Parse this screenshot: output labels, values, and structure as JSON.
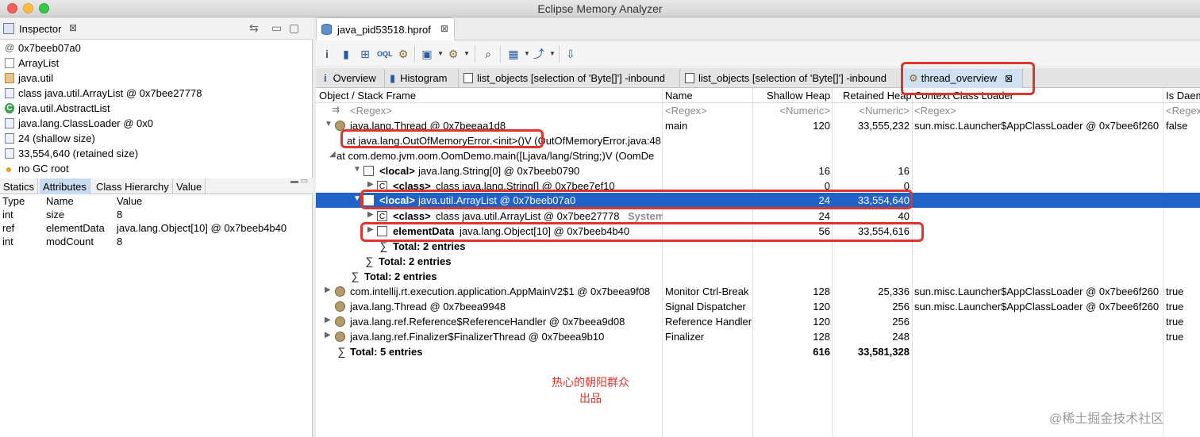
{
  "window": {
    "title": "Eclipse Memory Analyzer"
  },
  "inspector": {
    "title": "Inspector",
    "close": "⊠",
    "rows": [
      {
        "icon": "@",
        "text": "0x7beeb07a0"
      },
      {
        "icon": "file",
        "text": "ArrayList"
      },
      {
        "icon": "pkg",
        "text": "java.util"
      },
      {
        "icon": "obj",
        "text": "class java.util.ArrayList @ 0x7bee27778"
      },
      {
        "icon": "cls",
        "text": "java.util.AbstractList"
      },
      {
        "icon": "obj",
        "text": "java.lang.ClassLoader @ 0x0"
      },
      {
        "icon": "obj",
        "text": "24 (shallow size)"
      },
      {
        "icon": "obj",
        "text": "33,554,640 (retained size)"
      },
      {
        "icon": "dot",
        "text": "no GC root"
      }
    ],
    "tabs": [
      "Statics",
      "Attributes",
      "Class Hierarchy",
      "Value"
    ],
    "selected_tab": "Attributes",
    "columns": [
      "Type",
      "Name",
      "Value"
    ],
    "attributes": [
      {
        "type": "int",
        "name": "size",
        "value": "8"
      },
      {
        "type": "ref",
        "name": "elementData",
        "value": "java.lang.Object[10] @ 0x7beeb4b40"
      },
      {
        "type": "int",
        "name": "modCount",
        "value": "8"
      }
    ]
  },
  "editor": {
    "tab_label": "java_pid53518.hprof",
    "close": "⊠",
    "query_tabs": [
      {
        "label": "Overview"
      },
      {
        "label": "Histogram"
      },
      {
        "label": "list_objects [selection of 'Byte[]'] -inbound"
      },
      {
        "label": "list_objects [selection of 'Byte[]'] -inbound"
      },
      {
        "label": "thread_overview",
        "close": "⊠"
      }
    ]
  },
  "table": {
    "columns": [
      "Object / Stack Frame",
      "Name",
      "Shallow Heap",
      "Retained Heap",
      "Context Class Loader",
      "Is Daem"
    ],
    "filter": {
      "regex": "<Regex>",
      "numeric": "<Numeric>",
      "regex2": "<Regex>",
      "regex3": "<Regex"
    },
    "rows": [
      {
        "obj": "java.lang.Thread @ 0x7beeaa1d8",
        "name": "main",
        "shallow": "120",
        "retained": "33,555,232",
        "loader": "sun.misc.Launcher$AppClassLoader @ 0x7bee6f260",
        "daemon": "false"
      },
      {
        "obj": "at java.lang.OutOfMemoryError.<init>()V (OutOfMemoryError.java:48",
        "name": "",
        "shallow": "",
        "retained": "",
        "loader": "",
        "daemon": ""
      },
      {
        "obj": "at com.demo.jvm.oom.OomDemo.main([Ljava/lang/String;)V (OomDe",
        "name": "",
        "shallow": "",
        "retained": "",
        "loader": "",
        "daemon": ""
      },
      {
        "tag": "<local>",
        "obj": "java.lang.String[0] @ 0x7beeb0790",
        "name": "",
        "shallow": "16",
        "retained": "16",
        "loader": "",
        "daemon": ""
      },
      {
        "tag": "<class>",
        "obj": "class java.lang.String[] @ 0x7bee7ef10",
        "name": "",
        "shallow": "0",
        "retained": "0",
        "loader": "",
        "daemon": ""
      },
      {
        "tag": "<local>",
        "obj": "java.util.ArrayList @ 0x7beeb07a0",
        "name": "",
        "shallow": "24",
        "retained": "33,554,640",
        "loader": "",
        "daemon": ""
      },
      {
        "tag": "<class>",
        "obj": "class java.util.ArrayList @ 0x7bee27778",
        "suffix": "System",
        "name": "",
        "shallow": "24",
        "retained": "40",
        "loader": "",
        "daemon": ""
      },
      {
        "tag": "elementData",
        "obj": "java.lang.Object[10] @ 0x7beeb4b40",
        "name": "",
        "shallow": "56",
        "retained": "33,554,616",
        "loader": "",
        "daemon": ""
      },
      {
        "obj": "Total: 2 entries",
        "name": "",
        "shallow": "",
        "retained": "",
        "loader": "",
        "daemon": ""
      },
      {
        "obj": "Total: 2 entries",
        "name": "",
        "shallow": "",
        "retained": "",
        "loader": "",
        "daemon": ""
      },
      {
        "obj": "Total: 2 entries",
        "name": "",
        "shallow": "",
        "retained": "",
        "loader": "",
        "daemon": ""
      },
      {
        "obj": "com.intellij.rt.execution.application.AppMainV2$1 @ 0x7beea9f08",
        "name": "Monitor Ctrl-Break",
        "shallow": "128",
        "retained": "25,336",
        "loader": "sun.misc.Launcher$AppClassLoader @ 0x7bee6f260",
        "daemon": "true"
      },
      {
        "obj": "java.lang.Thread @ 0x7beea9948",
        "name": "Signal Dispatcher",
        "shallow": "120",
        "retained": "256",
        "loader": "sun.misc.Launcher$AppClassLoader @ 0x7bee6f260",
        "daemon": "true"
      },
      {
        "obj": "java.lang.ref.Reference$ReferenceHandler @ 0x7beea9d08",
        "name": "Reference Handler",
        "shallow": "120",
        "retained": "256",
        "loader": "",
        "daemon": "true"
      },
      {
        "obj": "java.lang.ref.Finalizer$FinalizerThread @ 0x7beea9b10",
        "name": "Finalizer",
        "shallow": "128",
        "retained": "248",
        "loader": "",
        "daemon": "true"
      },
      {
        "obj": "Total: 5 entries",
        "name": "",
        "shallow": "616",
        "retained": "33,581,328",
        "loader": "",
        "daemon": ""
      }
    ]
  },
  "watermark": {
    "line1": "热心的朝阳群众",
    "line2": "出品",
    "site": "@稀土掘金技术社区"
  },
  "colors": {
    "selection": "#1f63c8",
    "highlight": "#e0352b"
  }
}
